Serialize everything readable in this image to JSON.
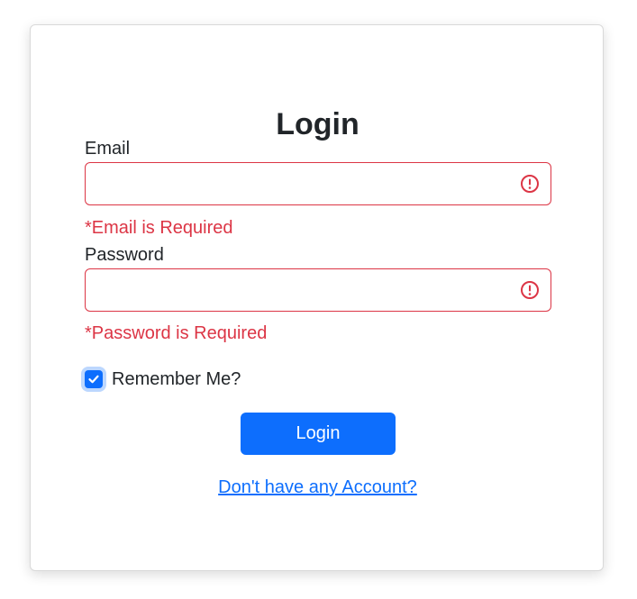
{
  "form": {
    "title": "Login",
    "email": {
      "label": "Email",
      "value": "",
      "error": "*Email is Required"
    },
    "password": {
      "label": "Password",
      "value": "",
      "error": "*Password is Required"
    },
    "remember": {
      "label": "Remember Me?",
      "checked": true
    },
    "submit_label": "Login",
    "signup_link": "Don't have any Account?"
  },
  "colors": {
    "primary": "#0d6efd",
    "danger": "#dc3545",
    "text": "#212529"
  },
  "icons": {
    "field_error": "exclamation-circle-icon",
    "checkbox_check": "check-icon"
  }
}
